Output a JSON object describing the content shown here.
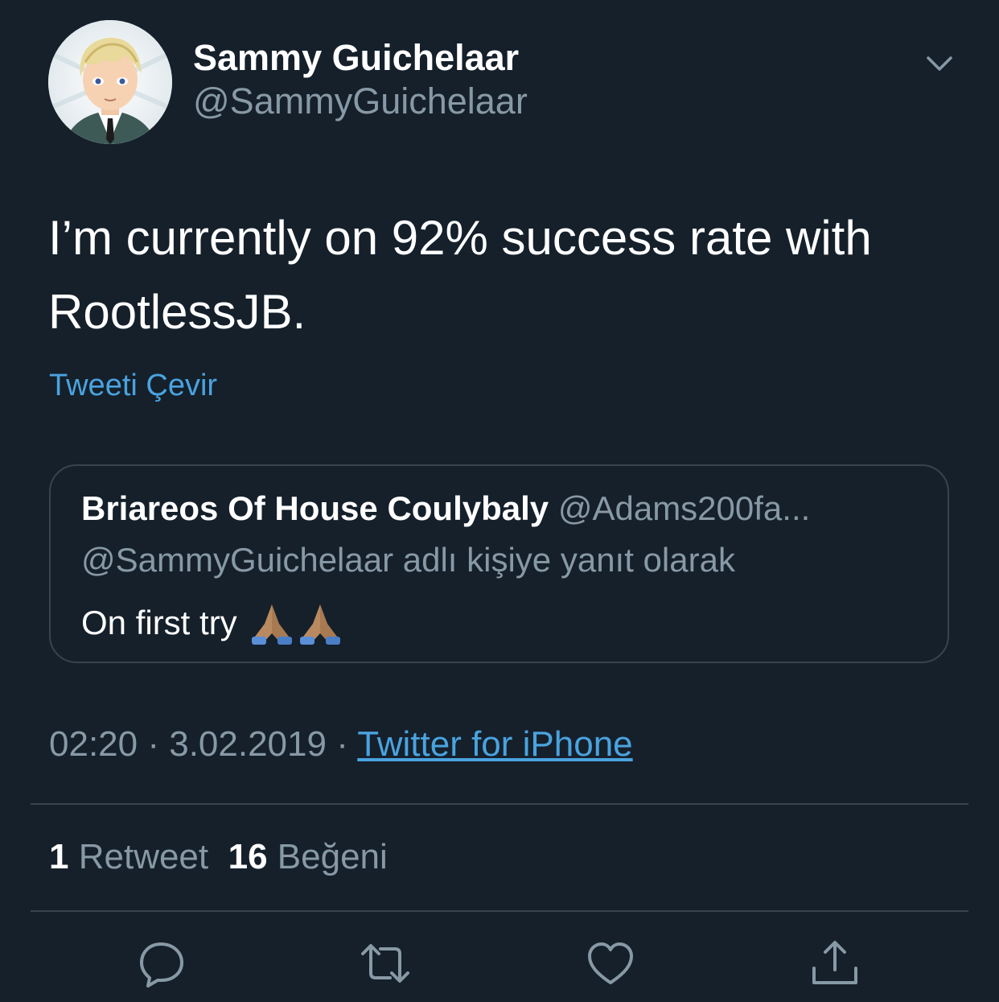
{
  "author": {
    "display_name": "Sammy Guichelaar",
    "handle": "@SammyGuichelaar",
    "avatar_icon": "cartoon-avatar"
  },
  "tweet": {
    "text": "I’m currently on 92% success rate with RootlessJB.",
    "translate_label": "Tweeti Çevir"
  },
  "quoted_tweet": {
    "display_name": "Briareos Of House Coulybaly",
    "handle": "@Adams200fa...",
    "reply_context": "@SammyGuichelaar adlı kişiye yanıt olarak",
    "text": "On first try",
    "emoji": [
      "folded-hands-emoji",
      "folded-hands-emoji"
    ]
  },
  "meta": {
    "time": "02:20",
    "separator": " · ",
    "date": "3.02.2019",
    "source": "Twitter for iPhone"
  },
  "stats": {
    "retweet_count": "1",
    "retweet_label": "Retweet",
    "like_count": "16",
    "like_label": "Beğeni"
  },
  "actions": [
    "reply-icon",
    "retweet-icon",
    "like-icon",
    "share-icon"
  ],
  "colors": {
    "background": "#15202b",
    "secondary_text": "#8899a6",
    "link": "#4aa3df",
    "border": "#38444d"
  }
}
